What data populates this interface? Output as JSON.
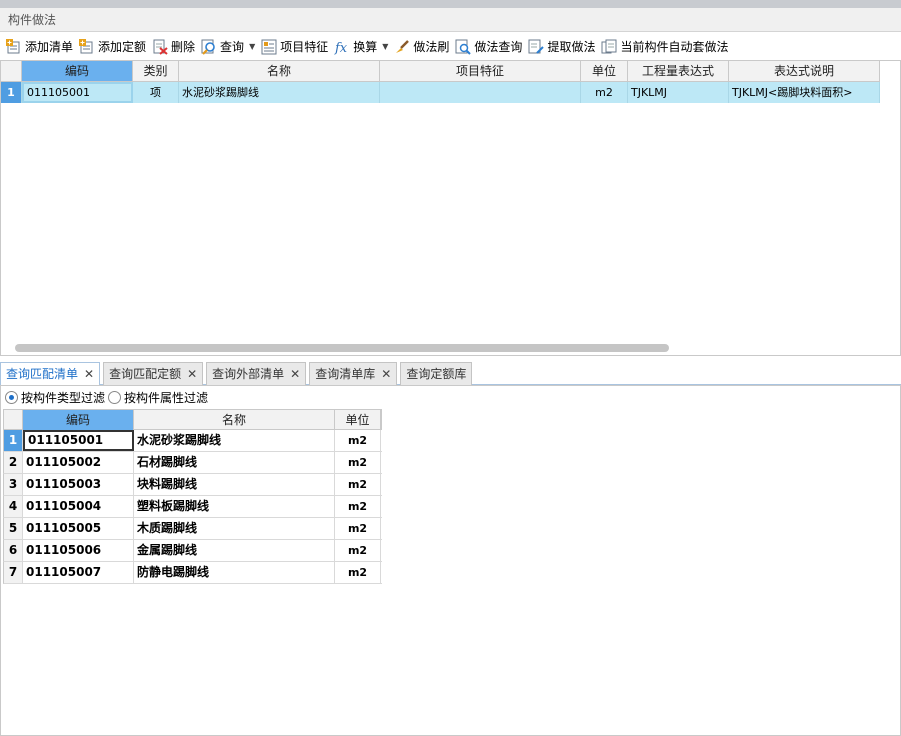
{
  "panel": {
    "title": "构件做法"
  },
  "toolbar": {
    "items": [
      {
        "label": "添加清单",
        "icon": "add-list-icon"
      },
      {
        "label": "添加定额",
        "icon": "add-quota-icon"
      },
      {
        "label": "删除",
        "icon": "delete-icon"
      },
      {
        "label": "查询",
        "icon": "query-icon",
        "dropdown": true
      },
      {
        "label": "项目特征",
        "icon": "project-feature-icon"
      },
      {
        "label": "换算",
        "icon": "fx-icon",
        "dropdown": true
      },
      {
        "label": "做法刷",
        "icon": "brush-icon"
      },
      {
        "label": "做法查询",
        "icon": "method-query-icon"
      },
      {
        "label": "提取做法",
        "icon": "extract-icon"
      },
      {
        "label": "当前构件自动套做法",
        "icon": "auto-apply-icon"
      }
    ]
  },
  "upper_grid": {
    "headers": [
      "编码",
      "类别",
      "名称",
      "项目特征",
      "单位",
      "工程量表达式",
      "表达式说明"
    ],
    "rows": [
      {
        "num": "1",
        "code": "011105001",
        "category": "项",
        "name": "水泥砂浆踢脚线",
        "feature": "",
        "unit": "m2",
        "expr": "TJKLMJ",
        "desc": "TJKLMJ<踢脚块料面积>"
      }
    ]
  },
  "tabs": [
    {
      "label": "查询匹配清单",
      "active": true
    },
    {
      "label": "查询匹配定额",
      "active": false
    },
    {
      "label": "查询外部清单",
      "active": false
    },
    {
      "label": "查询清单库",
      "active": false
    },
    {
      "label": "查询定额库",
      "active": false
    }
  ],
  "filter": {
    "option1": "按构件类型过滤",
    "option2": "按构件属性过滤",
    "selected": "option1"
  },
  "lower_grid": {
    "headers": [
      "编码",
      "名称",
      "单位"
    ],
    "rows": [
      {
        "num": "1",
        "code": "011105001",
        "name": "水泥砂浆踢脚线",
        "unit": "m2"
      },
      {
        "num": "2",
        "code": "011105002",
        "name": "石材踢脚线",
        "unit": "m2"
      },
      {
        "num": "3",
        "code": "011105003",
        "name": "块料踢脚线",
        "unit": "m2"
      },
      {
        "num": "4",
        "code": "011105004",
        "name": "塑料板踢脚线",
        "unit": "m2"
      },
      {
        "num": "5",
        "code": "011105005",
        "name": "木质踢脚线",
        "unit": "m2"
      },
      {
        "num": "6",
        "code": "011105006",
        "name": "金属踢脚线",
        "unit": "m2"
      },
      {
        "num": "7",
        "code": "011105007",
        "name": "防静电踢脚线",
        "unit": "m2"
      }
    ]
  },
  "colors": {
    "selected_row": "#bde8f6",
    "header_selected": "#6ab0ee",
    "active_tab_text": "#1e6fc8"
  }
}
